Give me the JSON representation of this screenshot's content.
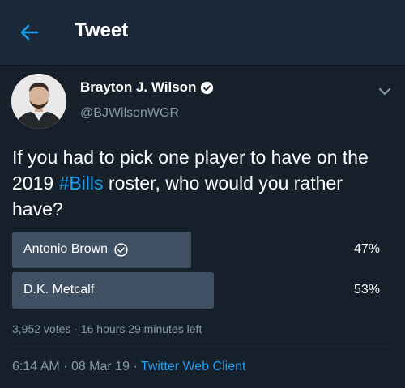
{
  "header": {
    "title": "Tweet",
    "back_icon": "back-arrow-icon"
  },
  "author": {
    "name": "Brayton J. Wilson",
    "handle": "@BJWilsonWGR",
    "verified_icon": "verified-badge-icon"
  },
  "tweet": {
    "text_before": "If you had to pick one player to have on the 2019 ",
    "hashtag": "#Bills",
    "text_after": " roster, who would you rather have?"
  },
  "poll": {
    "options": [
      {
        "label": "Antonio Brown",
        "percent_label": "47%",
        "percent": 47,
        "selected": true
      },
      {
        "label": "D.K. Metcalf",
        "percent_label": "53%",
        "percent": 53,
        "selected": false
      }
    ],
    "votes": "3,952 votes",
    "separator": "·",
    "time_left": "16 hours 29 minutes left"
  },
  "footer": {
    "time": "6:14 AM",
    "date": "08 Mar 19",
    "separator": "·",
    "client": "Twitter Web Client"
  },
  "colors": {
    "background": "#15202b",
    "header": "#1c2938",
    "accent": "#1da1f2",
    "muted": "#8899a6",
    "poll_bar": "#3e5061"
  }
}
